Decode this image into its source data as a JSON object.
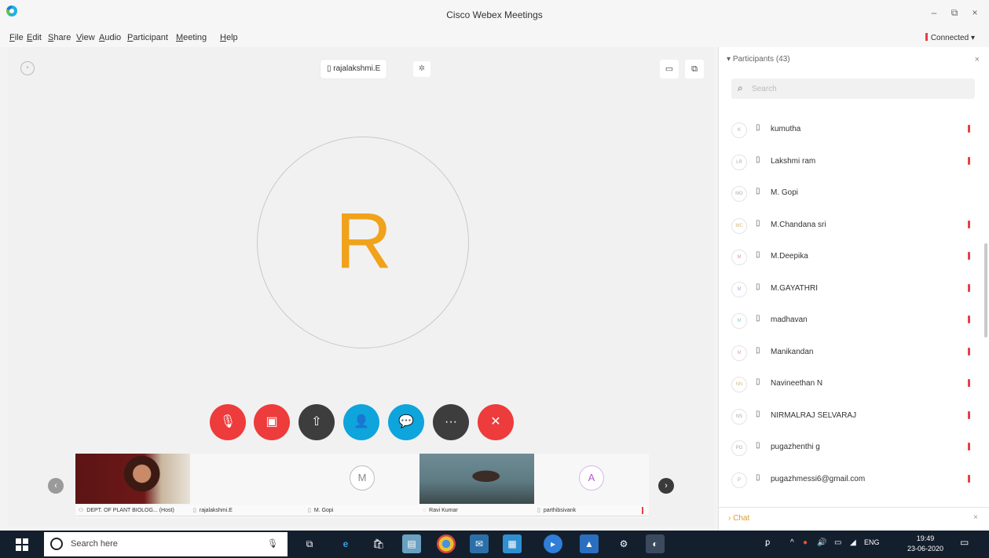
{
  "window": {
    "title": "Cisco Webex Meetings",
    "minimize": "–",
    "maximize": "⧉",
    "close": "×"
  },
  "menu": [
    "File",
    "Edit",
    "Share",
    "View",
    "Audio",
    "Participant",
    "Meeting",
    "Help"
  ],
  "status": {
    "connected": "Connected"
  },
  "stage": {
    "presenter": "rajalakshmi.E",
    "avatar_letter": "R",
    "avatar_color": "#f0a21a"
  },
  "controls": [
    {
      "name": "mute",
      "glyph": "🎙"
    },
    {
      "name": "stop-video",
      "glyph": "▣"
    },
    {
      "name": "share",
      "glyph": "⇧"
    },
    {
      "name": "participants",
      "glyph": "👤"
    },
    {
      "name": "chat",
      "glyph": "💬"
    },
    {
      "name": "more",
      "glyph": "···"
    },
    {
      "name": "leave",
      "glyph": "✕"
    }
  ],
  "thumbnails": [
    {
      "label": "DEPT. OF PLANT BIOLOG... (Host)",
      "kind": "video"
    },
    {
      "label": "rajalakshmi.E",
      "kind": "blank"
    },
    {
      "label": "M. Gopi",
      "kind": "initial",
      "initial": "M"
    },
    {
      "label": "Ravi Kumar",
      "kind": "video"
    },
    {
      "label": "parthibsivank",
      "kind": "initial",
      "initial": "A"
    }
  ],
  "panel": {
    "header": "Participants (43)",
    "search_placeholder": "Search",
    "participants": [
      {
        "initials": "K",
        "name": "kumutha",
        "muted": true
      },
      {
        "initials": "LR",
        "name": "Lakshmi ram",
        "muted": true
      },
      {
        "initials": "MG",
        "name": "M. Gopi",
        "muted": false
      },
      {
        "initials": "MC",
        "name": "M.Chandana sri",
        "muted": true
      },
      {
        "initials": "M",
        "name": "M.Deepika",
        "muted": true
      },
      {
        "initials": "M",
        "name": "M.GAYATHRI",
        "muted": true
      },
      {
        "initials": "M",
        "name": "madhavan",
        "muted": true
      },
      {
        "initials": "M",
        "name": "Manikandan",
        "muted": true
      },
      {
        "initials": "NN",
        "name": "Navineethan N",
        "muted": true
      },
      {
        "initials": "NS",
        "name": "NIRMALRAJ SELVARAJ",
        "muted": true
      },
      {
        "initials": "PG",
        "name": "pugazhenthi g",
        "muted": true
      },
      {
        "initials": "P",
        "name": "pugazhmessi6@gmail.com",
        "muted": true
      }
    ],
    "chat_label": "Chat"
  },
  "taskbar": {
    "search_text": "Search here",
    "lang": "ENG",
    "time": "19:49",
    "date": "23-06-2020"
  },
  "colors": {
    "accent_blue": "#0ea4dc",
    "danger_red": "#ee3b3b",
    "dark_button": "#3d3d3d",
    "taskbar": "#141f2e"
  }
}
